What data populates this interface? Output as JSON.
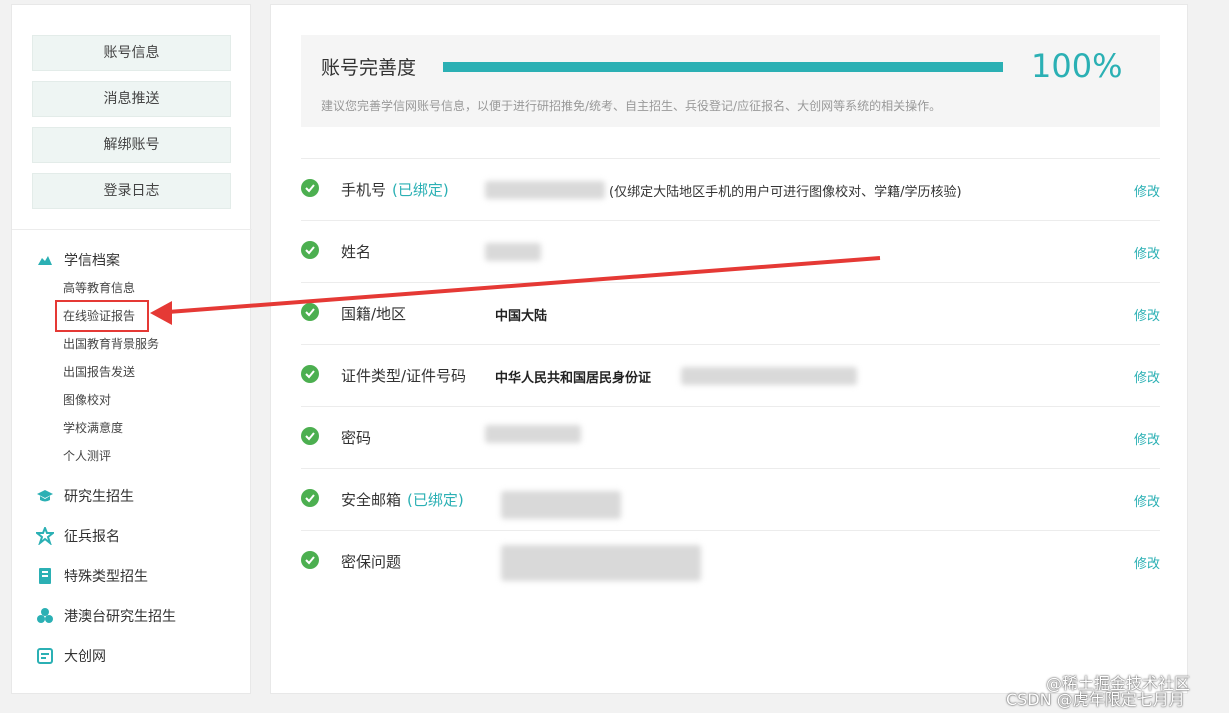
{
  "sidebar": {
    "account_buttons": [
      "账号信息",
      "消息推送",
      "解绑账号",
      "登录日志"
    ],
    "archive": {
      "label": "学信档案",
      "items": [
        "高等教育信息",
        "在线验证报告",
        "出国教育背景服务",
        "出国报告发送",
        "图像校对",
        "学校满意度",
        "个人测评"
      ]
    },
    "categories": [
      "研究生招生",
      "征兵报名",
      "特殊类型招生",
      "港澳台研究生招生",
      "大创网"
    ],
    "accent": "#2bb0b4"
  },
  "main": {
    "progress": {
      "title": "账号完善度",
      "percent_text": "100%",
      "fraction": 1.0,
      "hint": "建议您完善学信网账号信息，以便于进行研招推免/统考、自主招生、兵役登记/应征报名、大创网等系统的相关操作。"
    },
    "rows": [
      {
        "label": "手机号",
        "bound": "(已绑定)",
        "value": "",
        "note": "(仅绑定大陆地区手机的用户可进行图像校对、学籍/学历核验)",
        "edit": "修改"
      },
      {
        "label": "姓名",
        "bound": "",
        "value": "",
        "note": "",
        "edit": "修改"
      },
      {
        "label": "国籍/地区",
        "bound": "",
        "value": "中国大陆",
        "note": "",
        "edit": "修改"
      },
      {
        "label": "证件类型/证件号码",
        "bound": "",
        "value": "中华人民共和国居民身份证",
        "note": "",
        "edit": "修改"
      },
      {
        "label": "密码",
        "bound": "",
        "value": "",
        "note": "",
        "edit": "修改"
      },
      {
        "label": "安全邮箱",
        "bound": "(已绑定)",
        "value": "",
        "note": "",
        "edit": "修改"
      },
      {
        "label": "密保问题",
        "bound": "",
        "value": "",
        "note": "",
        "edit": "修改"
      }
    ]
  },
  "watermark": {
    "line1": "@稀土掘金技术社区",
    "line2": "CSDN @虎年限定七月月"
  },
  "colors": {
    "check": "#4caf50",
    "annotation": "#e53935"
  }
}
